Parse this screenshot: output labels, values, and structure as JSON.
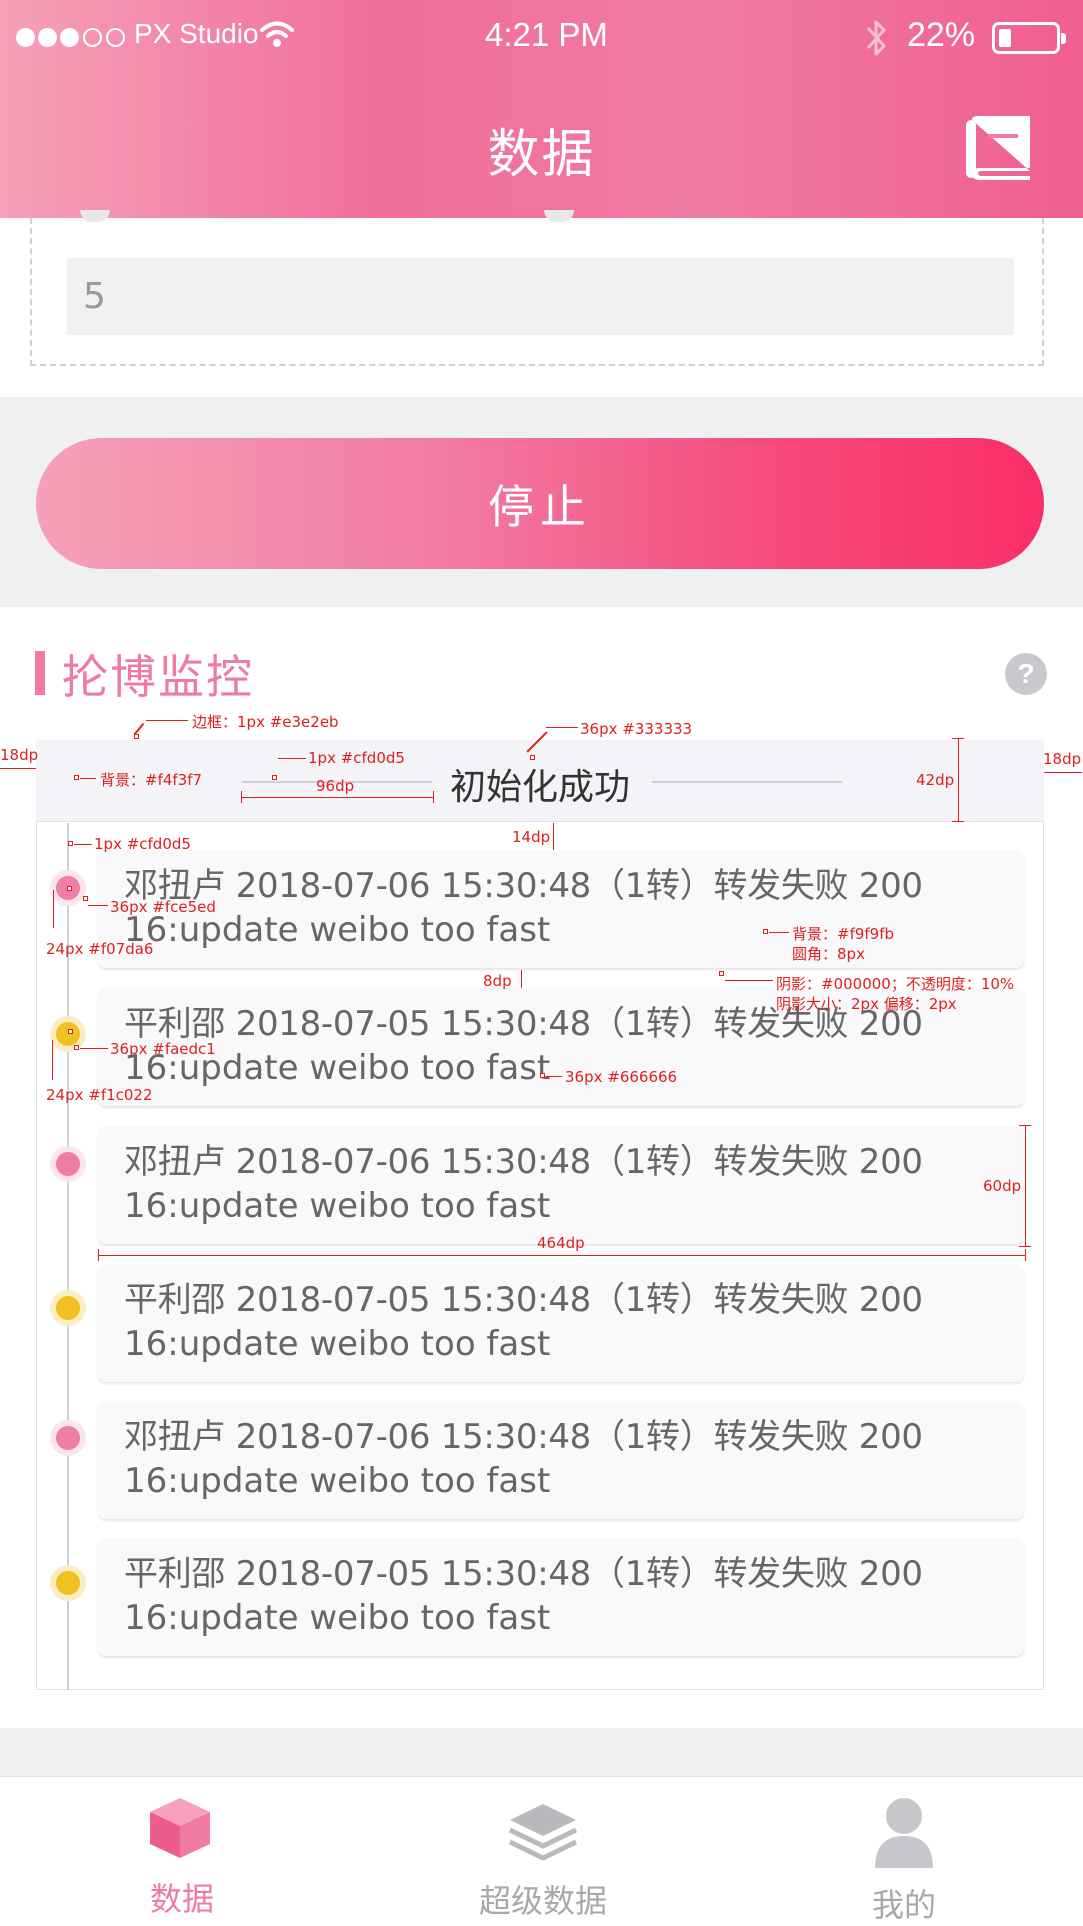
{
  "status_bar": {
    "carrier": "PX Studio",
    "time": "4:21 PM",
    "battery": "22%",
    "battery_level": 0.22,
    "signal_bars_filled": 3,
    "signal_bars_total": 5
  },
  "header": {
    "title": "数据",
    "book_icon": "book-icon"
  },
  "form": {
    "field_value": "5"
  },
  "stop_button_label": "停止",
  "section": {
    "title": "抡博监控",
    "help_label": "?",
    "init_status": "初始化成功"
  },
  "log_items": [
    {
      "line1": "邓扭卢 2018-07-06 15:30:48（1转）转发失败 200",
      "line2": "16:update weibo too fast",
      "dot": "pink"
    },
    {
      "line1": "平利邵 2018-07-05 15:30:48（1转）转发失败 200",
      "line2": "16:update weibo too fast",
      "dot": "yellow"
    },
    {
      "line1": "邓扭卢 2018-07-06 15:30:48（1转）转发失败 200",
      "line2": "16:update weibo too fast",
      "dot": "pink"
    },
    {
      "line1": "平利邵 2018-07-05 15:30:48（1转）转发失败 200",
      "line2": "16:update weibo too fast",
      "dot": "yellow"
    },
    {
      "line1": "邓扭卢 2018-07-06 15:30:48（1转）转发失败 200",
      "line2": "16:update weibo too fast",
      "dot": "pink"
    },
    {
      "line1": "平利邵 2018-07-05 15:30:48（1转）转发失败 200",
      "line2": "16:update weibo too fast",
      "dot": "yellow"
    }
  ],
  "annotations": {
    "border": "边框：1px #e3e2eb",
    "bg": "背景：#f4f3f7",
    "line_color": "1px #cfd0d5",
    "line_width": "96dp",
    "title_font": "36px #333333",
    "bar_height": "42dp",
    "left_margin": "18dp",
    "right_margin": "18dp",
    "gap_14": "14dp",
    "timeline_line": "1px #cfd0d5",
    "pink_outer": "36px #fce5ed",
    "pink_inner": "24px #f07da6",
    "card_bg": "背景：#f9f9fb",
    "card_radius": "圆角：8px",
    "gap_8": "8dp",
    "shadow1": "阴影：#000000；不透明度：10%",
    "shadow2": "阴影大小：2px 偏移：2px",
    "yellow_outer": "36px #faedc1",
    "yellow_inner": "24px #f1c022",
    "text_font": "36px #666666",
    "card_height": "60dp",
    "card_width": "464dp"
  },
  "tabs": [
    {
      "label": "数据",
      "active": true,
      "icon": "cube-icon"
    },
    {
      "label": "超级数据",
      "active": false,
      "icon": "layers-icon"
    },
    {
      "label": "我的",
      "active": false,
      "icon": "user-icon"
    }
  ],
  "colors": {
    "accent": "#f07aa0",
    "tab_active": "#f07aa0",
    "tab_inactive": "#a7a9ad"
  }
}
